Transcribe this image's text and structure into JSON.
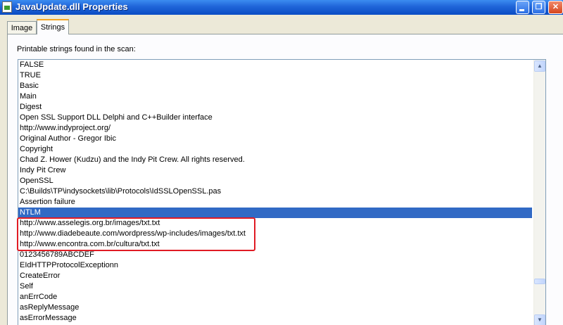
{
  "window": {
    "title": "JavaUpdate.dll Properties",
    "icon": "file-icon",
    "controls": {
      "minimize": "_",
      "maximize": "❐",
      "close": "✕"
    }
  },
  "tabs": [
    {
      "label": "Image",
      "active": false
    },
    {
      "label": "Strings",
      "active": true
    }
  ],
  "strings_page": {
    "caption": "Printable strings found in the scan:",
    "items": [
      "FALSE",
      "TRUE",
      "Basic",
      "Main",
      "Digest",
      "Open SSL Support DLL Delphi and C++Builder interface",
      "http://www.indyproject.org/",
      "Original Author - Gregor Ibic",
      "Copyright",
      "Chad Z. Hower (Kudzu) and the Indy Pit Crew. All rights reserved.",
      "Indy Pit Crew",
      "OpenSSL",
      "C:\\Builds\\TP\\indysockets\\lib\\Protocols\\IdSSLOpenSSL.pas",
      "Assertion failure",
      "NTLM",
      "http://www.asselegis.org.br/images/txt.txt",
      "http://www.diadebeaute.com/wordpress/wp-includes/images/txt.txt",
      "http://www.encontra.com.br/cultura/txt.txt",
      "0123456789ABCDEF",
      "EIdHTTPProtocolExceptionn",
      "CreateError",
      "Self",
      "anErrCode",
      "asReplyMessage",
      "asErrorMessage"
    ],
    "selected_index": 14
  },
  "scrollbar": {
    "up_icon": "▲",
    "down_icon": "▼"
  },
  "colors": {
    "title_bar": "#0a4cc4",
    "selection": "#316ac5",
    "highlight_box": "#e01b24",
    "active_tab_accent": "#f5a623"
  }
}
